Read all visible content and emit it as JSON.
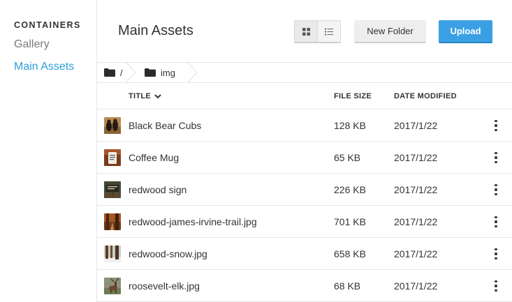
{
  "sidebar": {
    "heading": "CONTAINERS",
    "items": [
      {
        "label": "Gallery",
        "active": false
      },
      {
        "label": "Main Assets",
        "active": true
      }
    ]
  },
  "header": {
    "title": "Main Assets",
    "view_toggle": {
      "grid_icon": "grid-icon",
      "list_icon": "list-icon",
      "selected": "grid"
    },
    "new_folder_label": "New Folder",
    "upload_label": "Upload"
  },
  "breadcrumb": {
    "items": [
      {
        "label": "/",
        "icon": "folder-icon"
      },
      {
        "label": "img",
        "icon": "folder-icon"
      }
    ]
  },
  "table": {
    "columns": {
      "title": "TITLE",
      "size": "FILE SIZE",
      "date": "DATE MODIFIED"
    },
    "sort_icon": "chevron-down-icon",
    "rows": [
      {
        "title": "Black Bear Cubs",
        "size": "128 KB",
        "date": "2017/1/22"
      },
      {
        "title": "Coffee Mug",
        "size": "65 KB",
        "date": "2017/1/22"
      },
      {
        "title": "redwood sign",
        "size": "226 KB",
        "date": "2017/1/22"
      },
      {
        "title": "redwood-james-irvine-trail.jpg",
        "size": "701 KB",
        "date": "2017/1/22"
      },
      {
        "title": "redwood-snow.jpg",
        "size": "658 KB",
        "date": "2017/1/22"
      },
      {
        "title": "roosevelt-elk.jpg",
        "size": "68 KB",
        "date": "2017/1/22"
      }
    ]
  },
  "colors": {
    "accent": "#2d9cdb",
    "upload_button": "#3aa0e3",
    "sidebar_inactive": "#7a7a7a",
    "border": "#e6e6e6"
  }
}
